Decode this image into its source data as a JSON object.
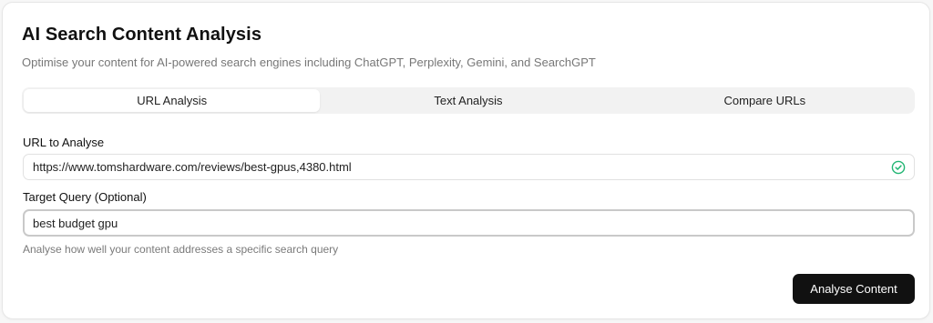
{
  "header": {
    "title": "AI Search Content Analysis",
    "subtitle": "Optimise your content for AI-powered search engines including ChatGPT, Perplexity, Gemini, and SearchGPT"
  },
  "tabs": [
    {
      "label": "URL Analysis",
      "active": true
    },
    {
      "label": "Text Analysis",
      "active": false
    },
    {
      "label": "Compare URLs",
      "active": false
    }
  ],
  "url_field": {
    "label": "URL to Analyse",
    "value": "https://www.tomshardware.com/reviews/best-gpus,4380.html",
    "status_icon": "check-circle-icon",
    "status_color": "#22b573"
  },
  "query_field": {
    "label": "Target Query (Optional)",
    "value": "best budget gpu",
    "hint": "Analyse how well your content addresses a specific search query"
  },
  "actions": {
    "submit_label": "Analyse Content"
  }
}
